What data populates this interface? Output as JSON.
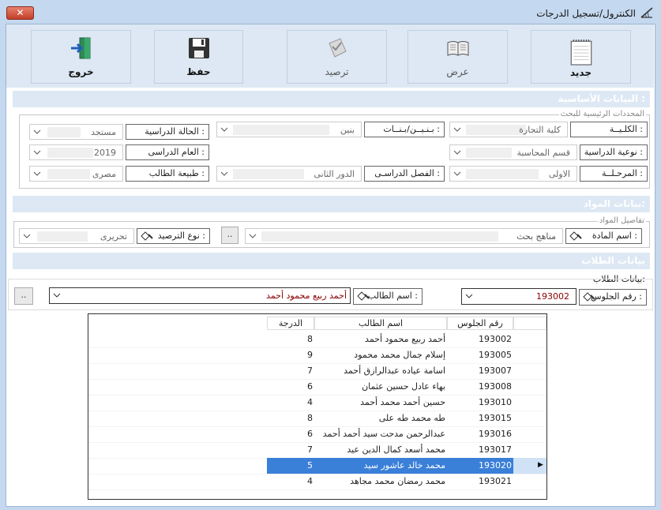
{
  "window": {
    "title": "الكنترول/تسجيل الدرجات",
    "close_label": "✕"
  },
  "toolbar": {
    "new_label": "جديد",
    "view_label": "عرض",
    "post_label": "ترصيد",
    "save_label": "حفظ",
    "exit_label": "خروج"
  },
  "basic": {
    "section_title": "البيانات الأساسية :",
    "group_legend": "المحددات الرئيسية للبحث",
    "faculty": {
      "label": "الكلـيــة :",
      "value": "كلية التجارة"
    },
    "gender": {
      "label": "بـنـيــن/بـنــات :",
      "value": "بنين"
    },
    "study_status": {
      "label": "الحالة الدراسية :",
      "value": "مستجد"
    },
    "study_type": {
      "label": "نوعية الدراسية :",
      "value": "قسم المحاسبة"
    },
    "academic_year": {
      "label": "العام الدراسى :",
      "value": "2019"
    },
    "stage": {
      "label": "المرحـلــة :",
      "value": "الاولى"
    },
    "semester": {
      "label": "الفصل الدراسـى :",
      "value": "الدور الثانى"
    },
    "student_nature": {
      "label": "طبيعة الطالب :",
      "value": "مصرى"
    }
  },
  "subjects": {
    "section_title": "بيانات المواد:",
    "group_legend": "تفاصيل المواد",
    "subject": {
      "label": "اسم المادة :",
      "value": "مناهج بحث"
    },
    "posting_type": {
      "label": "نوع الترصيد :",
      "value": "تحريرى"
    },
    "more_label": ".."
  },
  "students": {
    "section_title": "بيانات الطلاب",
    "group_legend": "بيانات الطلاب:",
    "seat": {
      "label": "رقم الجلوس :",
      "value": "193002"
    },
    "name": {
      "label": "اسم الطالب :",
      "value": "أحمد ربيع محمود أحمد"
    },
    "more_label": ".."
  },
  "grid": {
    "headers": {
      "seat": "رقم الجلوس",
      "name": "اسم الطالب",
      "score": "الدرجة"
    },
    "selected_marker": "▶",
    "rows": [
      {
        "seat": "193002",
        "name": "أحمد ربيع محمود أحمد",
        "score": "8"
      },
      {
        "seat": "193005",
        "name": "إسلام جمال محمد محمود",
        "score": "9"
      },
      {
        "seat": "193007",
        "name": "اسامة عياده عبدالرازق أحمد",
        "score": "7"
      },
      {
        "seat": "193008",
        "name": "بهاء عادل حسين عثمان",
        "score": "6"
      },
      {
        "seat": "193010",
        "name": "حسين أحمد محمد أحمد",
        "score": "4"
      },
      {
        "seat": "193015",
        "name": "طه محمد طه على",
        "score": "8"
      },
      {
        "seat": "193016",
        "name": "عبدالرحمن مدحت سيد أحمد أحمد",
        "score": "6"
      },
      {
        "seat": "193017",
        "name": "محمد أسعد كمال الدين عيد",
        "score": "7"
      },
      {
        "seat": "193020",
        "name": "محمد خالد عاشور سيد",
        "score": "5"
      },
      {
        "seat": "193021",
        "name": "محمد رمضان محمد مجاهد",
        "score": "4"
      }
    ]
  },
  "colors": {
    "selection": "#3a7fd8",
    "section": "#dde8f4",
    "title_bar": "#c4d8ef",
    "name_value": "#8b0000"
  }
}
